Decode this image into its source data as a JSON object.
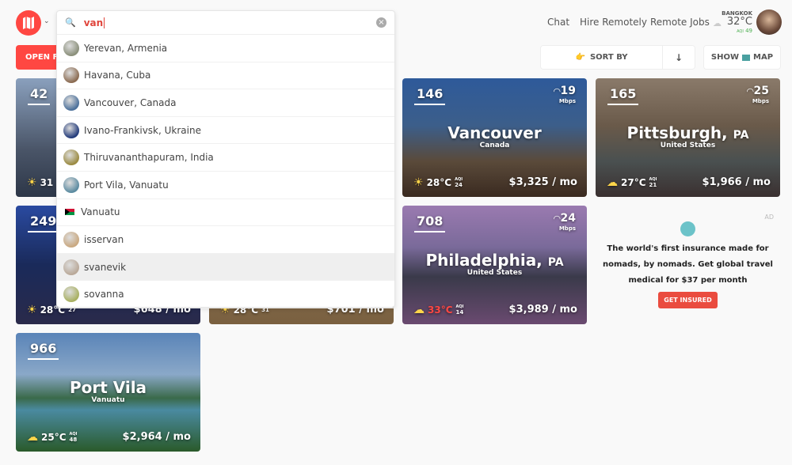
{
  "header": {
    "nav": [
      "Chat",
      "Hire Remotely",
      "Remote Jobs"
    ],
    "weather": {
      "city": "BANGKOK",
      "temp": "32°C",
      "aqi_label": "AQI",
      "aqi": "49"
    }
  },
  "toolbar": {
    "open_filters": "OPEN FILTERS",
    "sort_by": "SORT BY",
    "sort_dir": "↓",
    "show_map": "SHOW",
    "map": "MAP"
  },
  "search": {
    "query": "van",
    "results": [
      {
        "label": "Yerevan, Armenia",
        "type": "city",
        "color": "#8a8f7a"
      },
      {
        "label": "Havana, Cuba",
        "type": "city",
        "color": "#8a6a50"
      },
      {
        "label": "Vancouver, Canada",
        "type": "city",
        "color": "#4a6f9a"
      },
      {
        "label": "Ivano-Frankivsk, Ukraine",
        "type": "city",
        "color": "#223a7a"
      },
      {
        "label": "Thiruvananthapuram, India",
        "type": "city",
        "color": "#9a8a40"
      },
      {
        "label": "Port Vila, Vanuatu",
        "type": "city",
        "color": "#5a8aa0"
      },
      {
        "label": "Vanuatu",
        "type": "country"
      },
      {
        "label": "isservan",
        "type": "user",
        "color": "#c9a880"
      },
      {
        "label": "svanevik",
        "type": "user",
        "color": "#b9a898"
      },
      {
        "label": "sovanna",
        "type": "user",
        "color": "#a8b060"
      }
    ]
  },
  "cards": [
    {
      "rank": "42",
      "temp": "31",
      "bg": "linear-gradient(#8aa0bd,#4a5568 60%,#2d3748)"
    },
    {
      "bg": "linear-gradient(#6a7c98,#3d4658)"
    },
    {
      "rank": "146",
      "wifi": "19",
      "wifi_unit": "Mbps",
      "name": "Vancouver",
      "country": "Canada",
      "temp": "28°C",
      "aqi_label": "AQI",
      "aqi": "24",
      "price": "$3,325 / mo",
      "bg": "linear-gradient(#2e5a9a,#3c5e8a 40%,#5a4a3a 70%,#3a2a20)"
    },
    {
      "rank": "165",
      "wifi": "25",
      "wifi_unit": "Mbps",
      "name": "Pittsburgh,",
      "name_suffix": "PA",
      "country": "United States",
      "temp": "27°C",
      "aqi_label": "AQI",
      "aqi": "21",
      "price": "$1,966 / mo",
      "bg": "linear-gradient(#8a7a6a,#6a5a4a 40%,#4a5050 70%,#3a3030)"
    },
    {
      "rank": "249",
      "temp": "28°C",
      "aqi": "27",
      "price": "$648 / mo",
      "bg": "linear-gradient(#2a4aa0,#1a2a5a 50%,#2a2a4a)"
    },
    {
      "temp": "28°C",
      "aqi": "31",
      "price": "$701 / mo",
      "bg": "linear-gradient(#8a7a5a,#7a6040)"
    },
    {
      "rank": "708",
      "wifi": "24",
      "wifi_unit": "Mbps",
      "name": "Philadelphia,",
      "name_suffix": "PA",
      "country": "United States",
      "temp": "33°C",
      "temp_color": "#ff4742",
      "aqi_label": "AQI",
      "aqi": "14",
      "price": "$3,989 / mo",
      "bg": "linear-gradient(#9a7ab0,#7a6a9a 35%,#3a3a4a 60%,#6a4a70)"
    },
    {
      "rank": "966",
      "name": "Port Vila",
      "country": "Vanuatu",
      "temp": "25°C",
      "aqi_label": "AQI",
      "aqi": "48",
      "price": "$2,964 / mo",
      "bg": "linear-gradient(#5a84b8,#8aa8c8 35%,#3a6a4a 55%,#4a8aa0 65%,#2a5a2a)"
    }
  ],
  "ad": {
    "tag": "AD",
    "text": "The world's first insurance made for nomads, by nomads. Get global travel medical for $37 per month",
    "button": "GET INSURED"
  }
}
